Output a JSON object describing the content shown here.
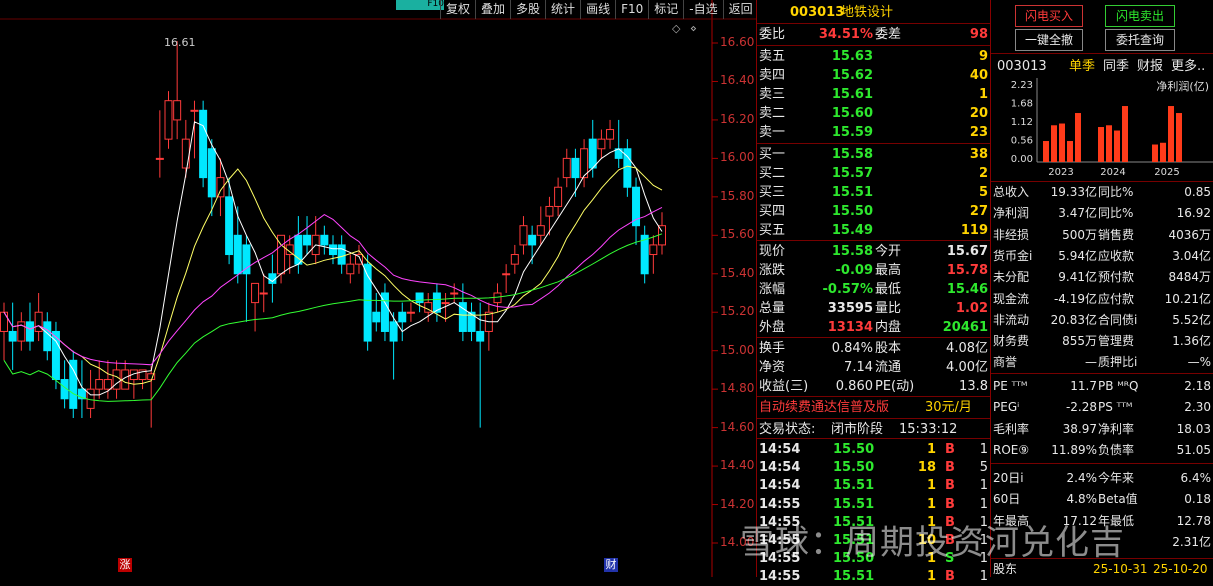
{
  "toolbar": {
    "tab": "F10",
    "items": [
      "复权",
      "叠加",
      "多股",
      "统计",
      "画线",
      "F10",
      "标记",
      "-自选",
      "返回"
    ]
  },
  "chart": {
    "price_labels": [
      "16.60",
      "16.40",
      "16.20",
      "16.00",
      "15.80",
      "15.60",
      "15.40",
      "15.20",
      "15.00",
      "14.80",
      "14.60",
      "14.40",
      "14.20",
      "14.00"
    ],
    "high_marker": "16.61",
    "marker_zhang": "涨",
    "marker_cai": "财"
  },
  "chart_data": {
    "type": "candlestick",
    "ylim": [
      13.95,
      16.68
    ],
    "candles": [
      [
        15.1,
        15.2,
        14.95,
        15.25
      ],
      [
        15.1,
        15.05,
        14.9,
        15.25
      ],
      [
        15.05,
        15.15,
        15.0,
        15.2
      ],
      [
        15.15,
        15.05,
        15.0,
        15.25
      ],
      [
        15.1,
        15.2,
        15.05,
        15.3
      ],
      [
        15.15,
        15.0,
        14.95,
        15.2
      ],
      [
        15.1,
        14.85,
        14.8,
        15.15
      ],
      [
        14.85,
        14.75,
        14.7,
        14.95
      ],
      [
        14.95,
        14.7,
        14.65,
        15.0
      ],
      [
        14.8,
        14.75,
        14.65,
        14.95
      ],
      [
        14.7,
        14.8,
        14.65,
        14.9
      ],
      [
        14.8,
        14.85,
        14.75,
        14.95
      ],
      [
        14.8,
        14.85,
        14.75,
        14.95
      ],
      [
        14.8,
        14.9,
        14.75,
        14.95
      ],
      [
        14.8,
        14.9,
        14.8,
        14.95
      ],
      [
        14.85,
        14.9,
        14.75,
        14.9
      ],
      [
        14.85,
        14.9,
        14.8,
        14.9
      ],
      [
        14.85,
        14.88,
        14.6,
        14.92
      ],
      [
        16.0,
        16.0,
        15.9,
        16.25
      ],
      [
        16.1,
        16.3,
        16.05,
        16.35
      ],
      [
        16.2,
        16.3,
        16.1,
        16.61
      ],
      [
        15.95,
        16.1,
        15.9,
        16.2
      ],
      [
        16.25,
        16.25,
        16.0,
        16.3
      ],
      [
        16.25,
        15.9,
        15.85,
        16.3
      ],
      [
        16.05,
        15.8,
        15.7,
        16.1
      ],
      [
        15.8,
        15.9,
        15.7,
        16.0
      ],
      [
        15.8,
        15.5,
        15.45,
        15.9
      ],
      [
        15.6,
        15.4,
        15.35,
        15.75
      ],
      [
        15.55,
        15.4,
        15.15,
        15.6
      ],
      [
        15.25,
        15.35,
        15.1,
        15.35
      ],
      [
        15.3,
        15.3,
        15.2,
        15.4
      ],
      [
        15.4,
        15.35,
        15.25,
        15.5
      ],
      [
        15.4,
        15.6,
        15.35,
        15.6
      ],
      [
        15.5,
        15.55,
        15.4,
        15.6
      ],
      [
        15.6,
        15.45,
        15.4,
        15.7
      ],
      [
        15.6,
        15.55,
        15.5,
        15.7
      ],
      [
        15.5,
        15.6,
        15.45,
        15.7
      ],
      [
        15.6,
        15.55,
        15.5,
        15.65
      ],
      [
        15.55,
        15.5,
        15.45,
        15.6
      ],
      [
        15.55,
        15.45,
        15.4,
        15.6
      ],
      [
        15.4,
        15.45,
        15.35,
        15.5
      ],
      [
        15.45,
        15.5,
        15.4,
        15.55
      ],
      [
        15.45,
        15.05,
        15.0,
        15.5
      ],
      [
        15.2,
        15.15,
        15.1,
        15.3
      ],
      [
        15.3,
        15.1,
        15.05,
        15.35
      ],
      [
        15.15,
        15.05,
        14.85,
        15.2
      ],
      [
        15.2,
        15.15,
        15.05,
        15.25
      ],
      [
        15.2,
        15.2,
        15.15,
        15.25
      ],
      [
        15.3,
        15.25,
        15.2,
        15.3
      ],
      [
        15.2,
        15.25,
        15.15,
        15.3
      ],
      [
        15.3,
        15.2,
        15.15,
        15.35
      ],
      [
        15.25,
        15.25,
        15.15,
        15.3
      ],
      [
        15.3,
        15.3,
        15.25,
        15.35
      ],
      [
        15.25,
        15.1,
        15.05,
        15.35
      ],
      [
        15.2,
        15.1,
        15.05,
        15.25
      ],
      [
        15.1,
        15.05,
        14.6,
        15.25
      ],
      [
        15.1,
        15.2,
        15.0,
        15.25
      ],
      [
        15.25,
        15.3,
        15.2,
        15.35
      ],
      [
        15.4,
        15.4,
        15.3,
        15.45
      ],
      [
        15.45,
        15.5,
        15.4,
        15.55
      ],
      [
        15.55,
        15.65,
        15.5,
        15.7
      ],
      [
        15.6,
        15.55,
        15.45,
        15.65
      ],
      [
        15.6,
        15.65,
        15.55,
        15.75
      ],
      [
        15.7,
        15.75,
        15.6,
        15.8
      ],
      [
        15.75,
        15.85,
        15.7,
        15.9
      ],
      [
        15.9,
        16.0,
        15.85,
        16.05
      ],
      [
        16.0,
        15.9,
        15.8,
        16.05
      ],
      [
        15.9,
        16.05,
        15.85,
        16.1
      ],
      [
        16.1,
        15.95,
        15.9,
        16.2
      ],
      [
        16.05,
        16.1,
        16.0,
        16.15
      ],
      [
        16.1,
        16.15,
        16.05,
        16.2
      ],
      [
        16.05,
        16.0,
        15.95,
        16.2
      ],
      [
        16.05,
        15.85,
        15.8,
        16.1
      ],
      [
        15.85,
        15.65,
        15.55,
        15.9
      ],
      [
        15.6,
        15.4,
        15.35,
        15.65
      ],
      [
        15.5,
        15.55,
        15.4,
        15.6
      ],
      [
        15.55,
        15.65,
        15.5,
        15.72
      ]
    ]
  },
  "quote": {
    "code": "003013",
    "name": "地铁设计",
    "weibi_label": "委比",
    "weibi": "34.51%",
    "weicha_label": "委差",
    "weicha": "98",
    "asks": [
      {
        "label": "卖五",
        "price": "15.63",
        "vol": "9"
      },
      {
        "label": "卖四",
        "price": "15.62",
        "vol": "40"
      },
      {
        "label": "卖三",
        "price": "15.61",
        "vol": "1"
      },
      {
        "label": "卖二",
        "price": "15.60",
        "vol": "20"
      },
      {
        "label": "卖一",
        "price": "15.59",
        "vol": "23"
      }
    ],
    "bids": [
      {
        "label": "买一",
        "price": "15.58",
        "vol": "38"
      },
      {
        "label": "买二",
        "price": "15.57",
        "vol": "2"
      },
      {
        "label": "买三",
        "price": "15.51",
        "vol": "5"
      },
      {
        "label": "买四",
        "price": "15.50",
        "vol": "27"
      },
      {
        "label": "买五",
        "price": "15.49",
        "vol": "119"
      }
    ],
    "stats": [
      {
        "l1": "现价",
        "v1": "15.58",
        "c1": "green",
        "l2": "今开",
        "v2": "15.67",
        "c2": "white"
      },
      {
        "l1": "涨跌",
        "v1": "-0.09",
        "c1": "green",
        "l2": "最高",
        "v2": "15.78",
        "c2": "red"
      },
      {
        "l1": "涨幅",
        "v1": "-0.57%",
        "c1": "green",
        "l2": "最低",
        "v2": "15.46",
        "c2": "green"
      },
      {
        "l1": "总量",
        "v1": "33595",
        "c1": "white",
        "l2": "量比",
        "v2": "1.02",
        "c2": "red"
      },
      {
        "l1": "外盘",
        "v1": "13134",
        "c1": "red",
        "l2": "内盘",
        "v2": "20461",
        "c2": "green"
      }
    ],
    "stats2": [
      {
        "l1": "换手",
        "v1": "0.84%",
        "l2": "股本",
        "v2": "4.08亿"
      },
      {
        "l1": "净资",
        "v1": "7.14",
        "l2": "流通",
        "v2": "4.00亿"
      },
      {
        "l1": "收益(三)",
        "v1": "0.860",
        "l2": "PE(动)",
        "v2": "13.8"
      }
    ],
    "promo": "自动续费通达信普及版",
    "promo_price": "30元/月",
    "status_label": "交易状态:",
    "status": "闭市阶段",
    "status_time": "15:33:12",
    "ticks": [
      {
        "t": "14:54",
        "p": "15.50",
        "v": "1",
        "d": "B",
        "n": "1"
      },
      {
        "t": "14:54",
        "p": "15.50",
        "v": "18",
        "d": "B",
        "n": "5"
      },
      {
        "t": "14:54",
        "p": "15.51",
        "v": "1",
        "d": "B",
        "n": "1"
      },
      {
        "t": "14:55",
        "p": "15.51",
        "v": "1",
        "d": "B",
        "n": "1"
      },
      {
        "t": "14:55",
        "p": "15.51",
        "v": "1",
        "d": "B",
        "n": "1"
      },
      {
        "t": "14:55",
        "p": "15.51",
        "v": "10",
        "d": "B",
        "n": "1"
      },
      {
        "t": "14:55",
        "p": "15.50",
        "v": "1",
        "d": "S",
        "n": "1"
      },
      {
        "t": "14:55",
        "p": "15.51",
        "v": "1",
        "d": "B",
        "n": "1"
      }
    ]
  },
  "right": {
    "buy_btn": "闪电买入",
    "sell_btn": "闪电卖出",
    "cancel_btn": "一键全撤",
    "query_btn": "委托查询",
    "code": "003013",
    "tabs": [
      "单季",
      "同季",
      "财报",
      "更多.."
    ],
    "chart_title": "净利润(亿)",
    "y_ticks": [
      "2.23",
      "1.68",
      "1.12",
      "0.56",
      "0.00"
    ],
    "years": [
      "2023",
      "2024",
      "2025"
    ],
    "fin": [
      {
        "l1": "总收入",
        "v1": "19.33亿",
        "l2": "同比%",
        "v2": "0.85"
      },
      {
        "l1": "净利润",
        "v1": "3.47亿",
        "l2": "同比%",
        "v2": "16.92"
      },
      {
        "l1": "非经损",
        "v1": "500万",
        "l2": "销售费",
        "v2": "4036万"
      },
      {
        "l1": "货币金i",
        "v1": "5.94亿",
        "l2": "应收款",
        "v2": "3.04亿"
      },
      {
        "l1": "未分配",
        "v1": "9.41亿",
        "l2": "预付款",
        "v2": "8484万"
      },
      {
        "l1": "现金流",
        "v1": "-4.19亿",
        "l2": "应付款",
        "v2": "10.21亿"
      },
      {
        "l1": "非流动",
        "v1": "20.83亿",
        "l2": "合同债i",
        "v2": "5.52亿"
      },
      {
        "l1": "财务费",
        "v1": "855万",
        "l2": "管理费",
        "v2": "1.36亿"
      },
      {
        "l1": "商誉",
        "v1": "—",
        "l2": "质押比i",
        "v2": "—%"
      }
    ],
    "val": [
      {
        "l1": "PE ᵀᵀᴹ",
        "v1": "11.7",
        "l2": "PB ᴹᴿQ",
        "v2": "2.18"
      },
      {
        "l1": "PEGⁱ",
        "v1": "-2.28",
        "l2": "PS ᵀᵀᴹ",
        "v2": "2.30"
      },
      {
        "l1": "毛利率",
        "v1": "38.97",
        "l2": "净利率",
        "v2": "18.03"
      },
      {
        "l1": "ROE⑨",
        "v1": "11.89%",
        "l2": "负债率",
        "v2": "51.05"
      }
    ],
    "perf": [
      {
        "l1": "20日i",
        "v1": "2.4%",
        "l2": "今年来",
        "v2": "6.4%"
      },
      {
        "l1": "60日",
        "v1": "4.8%",
        "l2": "Beta值",
        "v2": "0.18"
      },
      {
        "l1": "年最高",
        "v1": "17.12",
        "l2": "年最低",
        "v2": "12.78"
      },
      {
        "l1": "",
        "v1": "",
        "l2": "",
        "v2": "2.31亿"
      }
    ],
    "footer": {
      "l": "股东",
      "d1": "25-10-31",
      "d2": "25-10-20"
    }
  },
  "watermark": "雪球：周期投资河兑化吉"
}
